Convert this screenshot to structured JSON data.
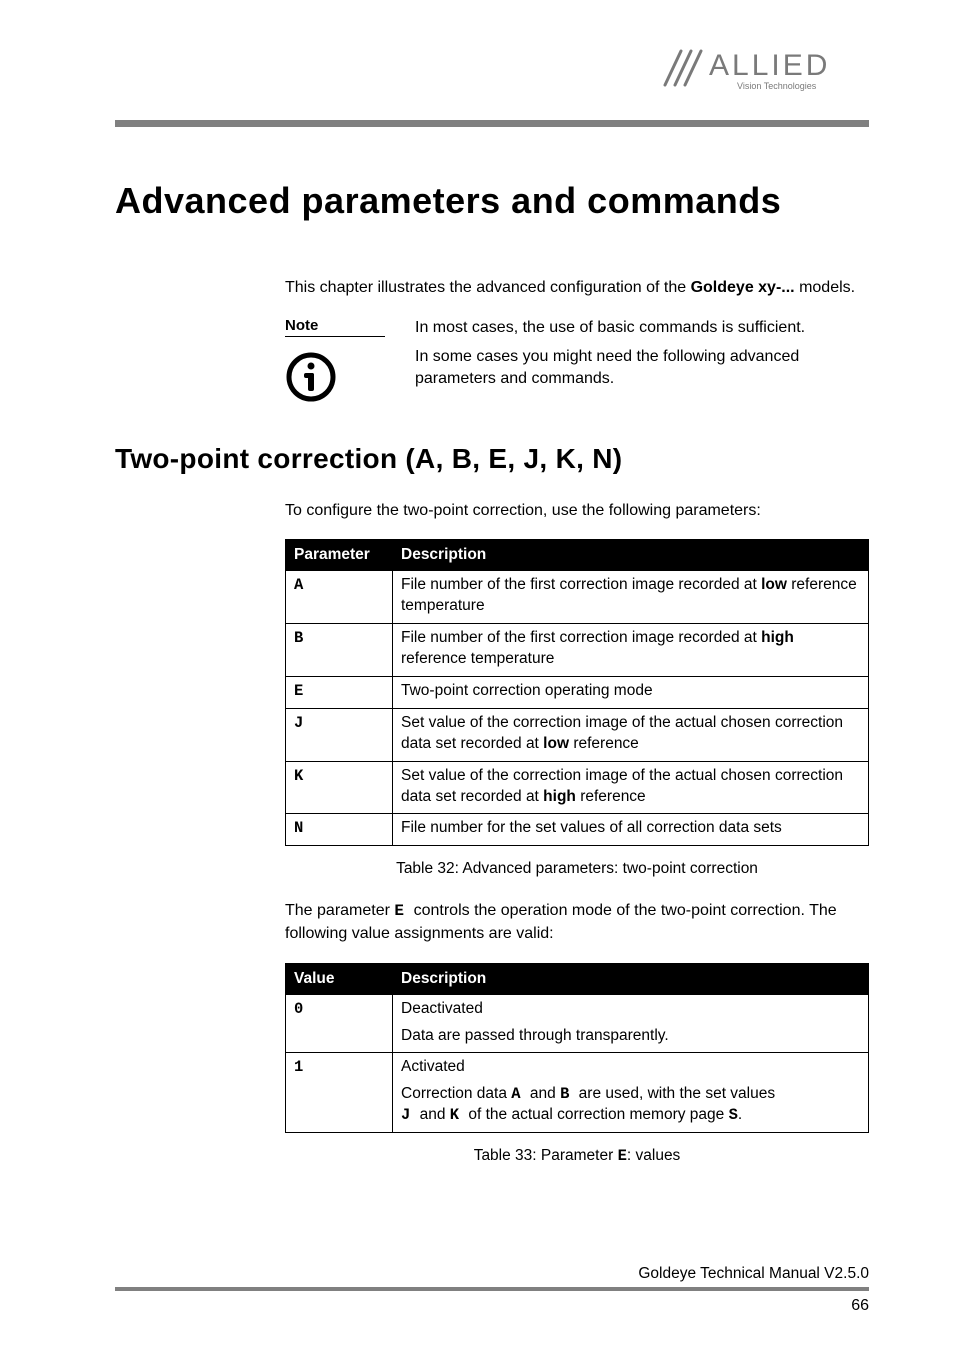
{
  "header": {
    "logo_main": "ALLIED",
    "logo_sub": "Vision Technologies"
  },
  "chapter_title": "Advanced parameters and commands",
  "intro_pre": "This chapter illustrates the advanced configuration of the ",
  "intro_bold": "Goldeye xy-...",
  "intro_post": " models.",
  "note": {
    "label": "Note",
    "line1": "In most cases, the use of basic commands is sufficient.",
    "line2": "In some cases you might need the following advanced parameters and commands."
  },
  "section_title": "Two-point correction (A, B, E, J, K, N)",
  "section_intro": "To configure the two-point correction, use the following parameters:",
  "table1": {
    "head_param": "Parameter",
    "head_desc": "Description",
    "rows": [
      {
        "p": "A",
        "d_pre": "File number of the first correction image recorded at ",
        "d_bold": "low",
        "d_post": " reference temperature"
      },
      {
        "p": "B",
        "d_pre": "File number of the first correction image recorded at ",
        "d_bold": "high",
        "d_post": " reference temperature"
      },
      {
        "p": "E",
        "d_pre": "Two-point correction operating mode",
        "d_bold": "",
        "d_post": ""
      },
      {
        "p": "J",
        "d_pre": "Set value of the correction image of the actual chosen correction data set recorded at ",
        "d_bold": "low",
        "d_post": " reference"
      },
      {
        "p": "K",
        "d_pre": "Set value of the correction image of the actual chosen correction data set recorded at ",
        "d_bold": "high",
        "d_post": " reference"
      },
      {
        "p": "N",
        "d_pre": "File number for the set values of all correction data sets",
        "d_bold": "",
        "d_post": ""
      }
    ],
    "caption": "Table 32: Advanced parameters: two-point correction"
  },
  "mid_para": {
    "pre": "The parameter ",
    "code": " E ",
    "post": " controls the operation mode of the two-point correction. The following value assignments are valid:"
  },
  "table2": {
    "head_val": "Value",
    "head_desc": "Description",
    "rows": [
      {
        "v": "0",
        "line1": "Deactivated",
        "line2": "Data are passed through transparently."
      },
      {
        "v": "1",
        "line1": "Activated",
        "l2_a": "Correction data ",
        "l2_A": " A ",
        "l2_b": " and ",
        "l2_B": " B ",
        "l2_c": " are used, with the set values ",
        "l2_J": " J ",
        "l2_d": " and ",
        "l2_K": " K ",
        "l2_e": " of the actual correction memory page ",
        "l2_S": " S",
        "l2_f": "."
      }
    ],
    "caption_pre": "Table 33: Parameter ",
    "caption_code": " E",
    "caption_post": ": values"
  },
  "footer": {
    "manual": "Goldeye Technical Manual V2.5.0",
    "page": "66"
  }
}
